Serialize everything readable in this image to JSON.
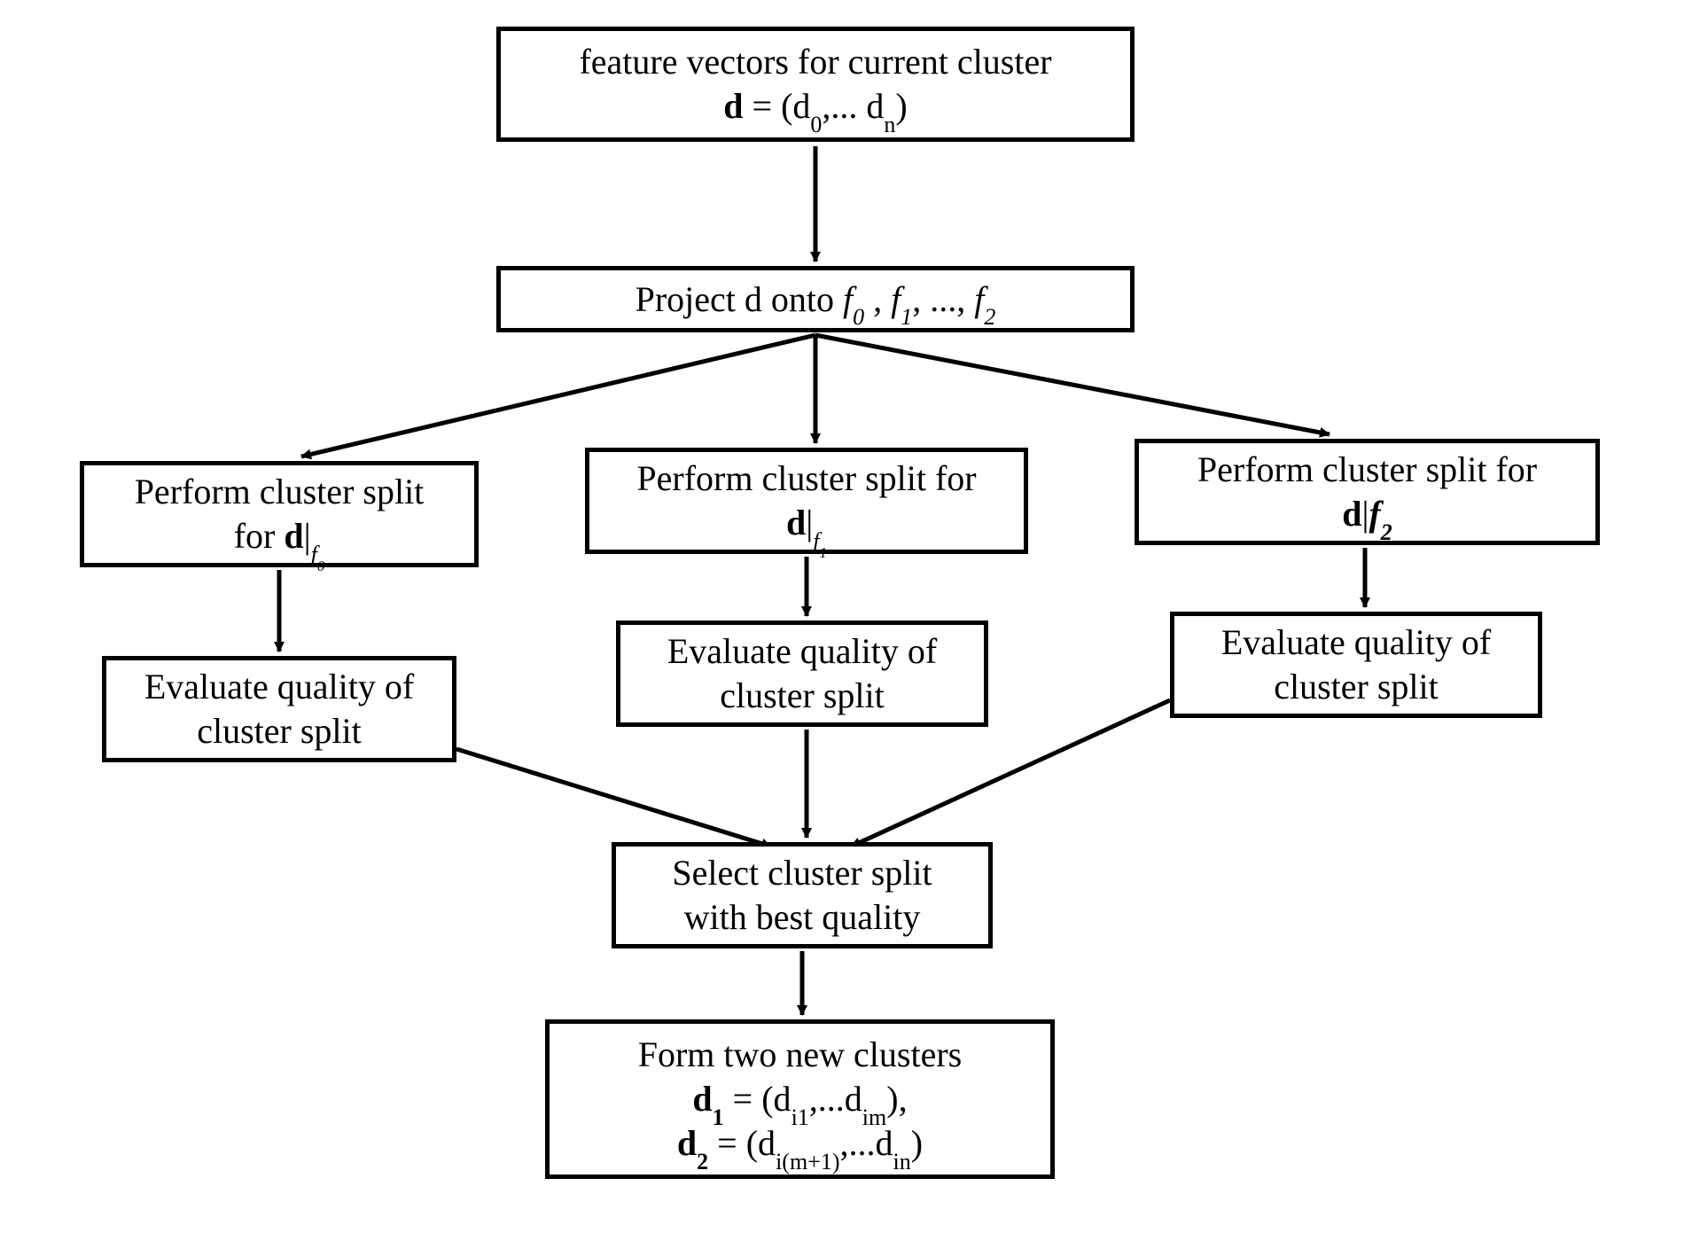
{
  "diagram": {
    "feature_line1": "feature vectors for current cluster",
    "feature_d": "d",
    "feature_eq": " = (d",
    "feature_sub0": "0",
    "feature_mid": ",... d",
    "feature_subn": "n",
    "feature_close": ")",
    "project_prefix": "Project d onto ",
    "project_f0": "f",
    "project_s0": "0",
    "project_sep1": "   , ",
    "project_f1": "f",
    "project_s1": "1",
    "project_dots": ", ..., ",
    "project_f2": "f",
    "project_s2": "2",
    "split_pre": "Perform cluster split",
    "split_for": "for ",
    "split_pre_for": "Perform cluster split for",
    "d_sym": "d",
    "bar": "|",
    "f_sym": "f",
    "sub_f0": "0",
    "sub_f1": "1",
    "sub_f2": "2",
    "eval_l1": "Evaluate quality of",
    "eval_l2": "cluster split",
    "select_l1": "Select cluster split",
    "select_l2": "with best quality",
    "form_l1": "Form two new clusters",
    "form_d1": "d",
    "form_s1": "1",
    "form_eq1a": " = (d",
    "form_s_i1": "i1",
    "form_mid1": ",...d",
    "form_s_im": "im",
    "form_close1": "),",
    "form_d2": "d",
    "form_s2": "2",
    "form_eq2a": " = (d",
    "form_s_imp1": "i(m+1)",
    "form_mid2": ",...d",
    "form_s_in": "in",
    "form_close2": ")"
  }
}
